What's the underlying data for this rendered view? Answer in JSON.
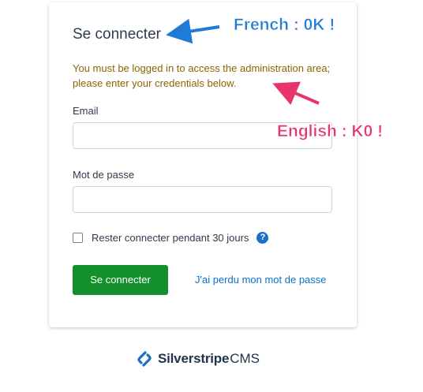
{
  "login": {
    "title": "Se connecter",
    "message": "You must be logged in to access the administration area; please enter your credentials below.",
    "email_label": "Email",
    "email_value": "",
    "password_label": "Mot de passe",
    "password_value": "",
    "remember_label": "Rester connecter pendant 30 jours",
    "remember_checked": false,
    "help_glyph": "?",
    "submit_label": "Se connecter",
    "forgot_label": "J'ai perdu mon mot de passe"
  },
  "brand": {
    "name": "Silverstripe",
    "suffix": "CMS",
    "color": "#1d6fc6"
  },
  "annotations": {
    "french": "French : 0K !",
    "english": "English : K0 !",
    "french_color": "#1e7bd6",
    "english_color": "#e8346a"
  }
}
